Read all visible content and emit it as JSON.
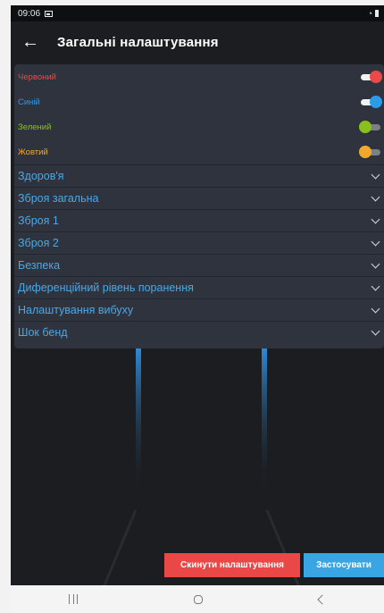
{
  "status_bar": {
    "time": "09:06"
  },
  "header": {
    "title": "Загальні налаштування"
  },
  "toggles": [
    {
      "label": "Червоний",
      "color": "#e84a4a",
      "on": true
    },
    {
      "label": "Синій",
      "color": "#2c9ce6",
      "on": true
    },
    {
      "label": "Зелений",
      "color": "#8ac01c",
      "on": false
    },
    {
      "label": "Жовтий",
      "color": "#f0a92a",
      "on": false
    }
  ],
  "sections": [
    {
      "label": "Здоров'я"
    },
    {
      "label": "Зброя загальна"
    },
    {
      "label": "Зброя 1"
    },
    {
      "label": "Зброя 2"
    },
    {
      "label": "Безпека"
    },
    {
      "label": "Диференційний рівень поранення"
    },
    {
      "label": "Налаштування вибуху"
    },
    {
      "label": "Шок бенд"
    }
  ],
  "footer": {
    "reset_label": "Скинути налаштування",
    "apply_label": "Застосувати"
  },
  "colors": {
    "background": "#1c1d20",
    "panel": "#2f333d",
    "section_text": "#4aa8e6",
    "reset_button": "#ec4747",
    "apply_button": "#3aa5e3"
  }
}
